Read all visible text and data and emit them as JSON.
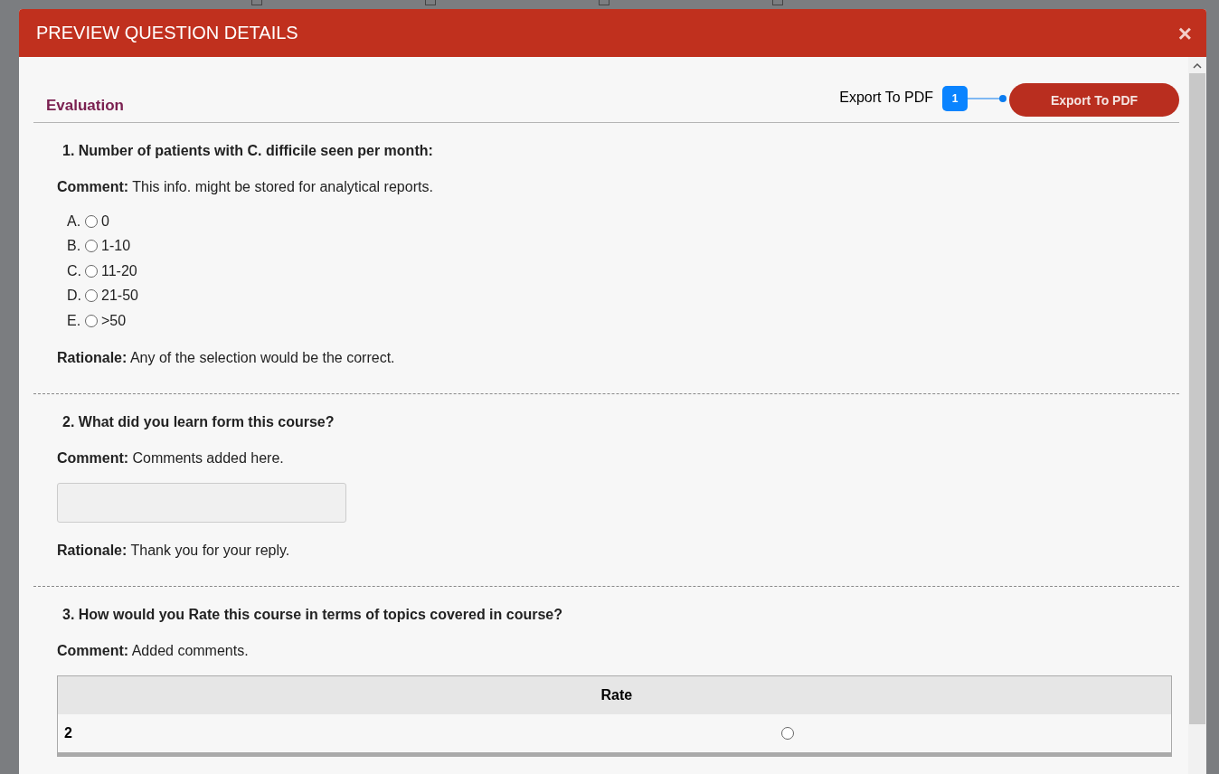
{
  "dialog": {
    "title": "PREVIEW QUESTION DETAILS",
    "close_glyph": "×"
  },
  "section": {
    "title": "Evaluation"
  },
  "callout": {
    "label": "Export To PDF",
    "badge": "1"
  },
  "export_button": "Export To PDF",
  "questions": [
    {
      "kind": "choice",
      "title": "1. Number of patients with C. difficile seen per month:",
      "comment_label": "Comment:",
      "comment": "This info. might be stored for analytical reports.",
      "options": [
        {
          "letter": "A.",
          "text": "0",
          "selected": false
        },
        {
          "letter": "B.",
          "text": "1-10",
          "selected": false
        },
        {
          "letter": "C.",
          "text": "11-20",
          "selected": false
        },
        {
          "letter": "D.",
          "text": "21-50",
          "selected": false
        },
        {
          "letter": "E.",
          "text": ">50",
          "selected": false
        }
      ],
      "rationale_label": "Rationale:",
      "rationale": "Any of the selection would be the correct."
    },
    {
      "kind": "text",
      "title": "2. What did you learn form this course?",
      "comment_label": "Comment:",
      "comment": "Comments added here.",
      "rationale_label": "Rationale:",
      "rationale": "Thank you for your reply."
    },
    {
      "kind": "rating",
      "title": "3. How would you Rate this course in terms of topics covered in course?",
      "comment_label": "Comment:",
      "comment": "Added comments.",
      "columns": [
        "Rate"
      ],
      "rows": [
        {
          "label": "2",
          "selected": false
        }
      ]
    }
  ]
}
